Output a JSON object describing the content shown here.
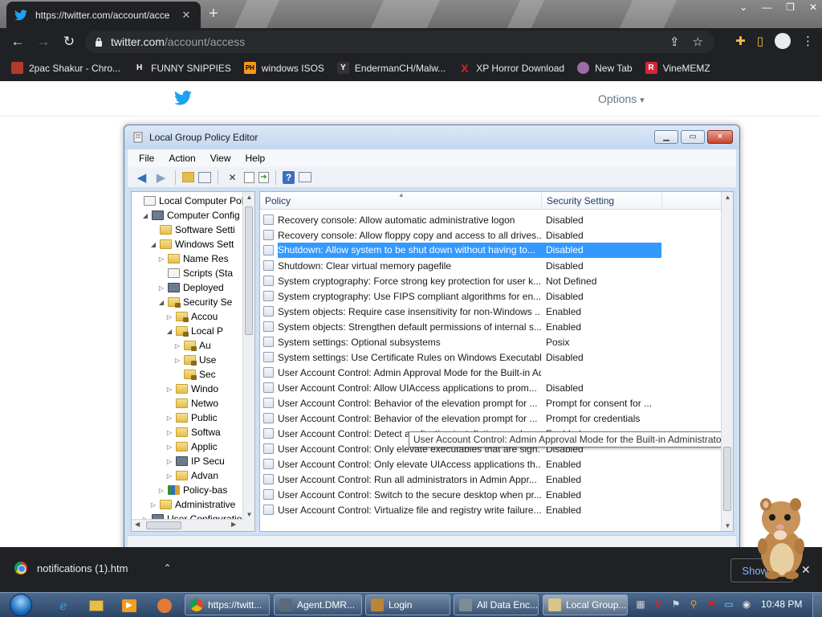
{
  "browser": {
    "tab_title": "https://twitter.com/account/acce",
    "tab_close": "✕",
    "new_tab": "+",
    "window_controls": [
      "⌄",
      "—",
      "❐",
      "✕"
    ],
    "omnibox_domain": "twitter.com",
    "omnibox_path": "/account/access",
    "bookmarks": [
      {
        "label": "2pac Shakur - Chro...",
        "icon": "pac-icon",
        "icon_text": "",
        "color": "#b23a2a"
      },
      {
        "label": "FUNNY SNIPPIES",
        "icon": "h-icon",
        "icon_text": "H",
        "color": "#222222"
      },
      {
        "label": "windows ISOS",
        "icon": "ph-icon",
        "icon_text": "PH",
        "color": "#f7971c"
      },
      {
        "label": "EndermanCH/Malw...",
        "icon": "yp-icon",
        "icon_text": "Y",
        "color": "#333333"
      },
      {
        "label": "XP Horror Download",
        "icon": "x-icon",
        "icon_text": "X",
        "color": "#e02020"
      },
      {
        "label": "New Tab",
        "icon": "globe-icon",
        "icon_text": "",
        "color": "#a06aa8"
      },
      {
        "label": "VineMEMZ",
        "icon": "r-icon",
        "icon_text": "R",
        "color": "#d4253a"
      }
    ]
  },
  "page": {
    "options_label": "Options",
    "options_caret": "▾"
  },
  "gpedit": {
    "title": "Local Group Policy Editor",
    "menu": [
      "File",
      "Action",
      "View",
      "Help"
    ],
    "tree": [
      {
        "label": "Local Computer Polic",
        "indent": 0,
        "arrow": "",
        "icon": "paper"
      },
      {
        "label": "Computer Config",
        "indent": 1,
        "arrow": "◢",
        "icon": "comp"
      },
      {
        "label": "Software Setti",
        "indent": 2,
        "arrow": "",
        "icon": "folder"
      },
      {
        "label": "Windows Sett",
        "indent": 2,
        "arrow": "◢",
        "icon": "folder"
      },
      {
        "label": "Name Res",
        "indent": 3,
        "arrow": "▷",
        "icon": "folder"
      },
      {
        "label": "Scripts (Sta",
        "indent": 3,
        "arrow": "",
        "icon": "paper"
      },
      {
        "label": "Deployed",
        "indent": 3,
        "arrow": "▷",
        "icon": "comp"
      },
      {
        "label": "Security Se",
        "indent": 3,
        "arrow": "◢",
        "icon": "lockf"
      },
      {
        "label": "Accou",
        "indent": 4,
        "arrow": "▷",
        "icon": "lockf"
      },
      {
        "label": "Local P",
        "indent": 4,
        "arrow": "◢",
        "icon": "lockf"
      },
      {
        "label": "Au",
        "indent": 5,
        "arrow": "▷",
        "icon": "lockf"
      },
      {
        "label": "Use",
        "indent": 5,
        "arrow": "▷",
        "icon": "lockf"
      },
      {
        "label": "Sec",
        "indent": 5,
        "arrow": "",
        "icon": "lockf"
      },
      {
        "label": "Windo",
        "indent": 4,
        "arrow": "▷",
        "icon": "folder"
      },
      {
        "label": "Netwo",
        "indent": 4,
        "arrow": "",
        "icon": "folder"
      },
      {
        "label": "Public",
        "indent": 4,
        "arrow": "▷",
        "icon": "folder"
      },
      {
        "label": "Softwa",
        "indent": 4,
        "arrow": "▷",
        "icon": "folder"
      },
      {
        "label": "Applic",
        "indent": 4,
        "arrow": "▷",
        "icon": "folder"
      },
      {
        "label": "IP Secu",
        "indent": 4,
        "arrow": "▷",
        "icon": "comp"
      },
      {
        "label": "Advan",
        "indent": 4,
        "arrow": "▷",
        "icon": "folder"
      },
      {
        "label": "Policy-bas",
        "indent": 3,
        "arrow": "▷",
        "icon": "chart"
      },
      {
        "label": "Administrative",
        "indent": 2,
        "arrow": "▷",
        "icon": "folder"
      },
      {
        "label": "User Configuratio",
        "indent": 1,
        "arrow": "▷",
        "icon": "comp"
      }
    ],
    "columns": {
      "policy": "Policy",
      "setting": "Security Setting"
    },
    "rows": [
      {
        "policy": "Recovery console: Allow automatic administrative logon",
        "setting": "Disabled"
      },
      {
        "policy": "Recovery console: Allow floppy copy and access to all drives...",
        "setting": "Disabled"
      },
      {
        "policy": "Shutdown: Allow system to be shut down without having to...",
        "setting": "Disabled"
      },
      {
        "policy": "Shutdown: Clear virtual memory pagefile",
        "setting": "Disabled"
      },
      {
        "policy": "System cryptography: Force strong key protection for user k...",
        "setting": "Not Defined"
      },
      {
        "policy": "System cryptography: Use FIPS compliant algorithms for en...",
        "setting": "Disabled"
      },
      {
        "policy": "System objects: Require case insensitivity for non-Windows ...",
        "setting": "Enabled"
      },
      {
        "policy": "System objects: Strengthen default permissions of internal s...",
        "setting": "Enabled"
      },
      {
        "policy": "System settings: Optional subsystems",
        "setting": "Posix"
      },
      {
        "policy": "System settings: Use Certificate Rules on Windows Executabl...",
        "setting": "Disabled"
      },
      {
        "policy": "User Account Control: Admin Approval Mode for the Built-in Administrator account",
        "setting": ""
      },
      {
        "policy": "User Account Control: Allow UIAccess applications to prom...",
        "setting": "Disabled"
      },
      {
        "policy": "User Account Control: Behavior of the elevation prompt for ...",
        "setting": "Prompt for consent for ..."
      },
      {
        "policy": "User Account Control: Behavior of the elevation prompt for ...",
        "setting": "Prompt for credentials"
      },
      {
        "policy": "User Account Control: Detect application installations and p...",
        "setting": "Enabled"
      },
      {
        "policy": "User Account Control: Only elevate executables that are sign...",
        "setting": "Disabled"
      },
      {
        "policy": "User Account Control: Only elevate UIAccess applications th...",
        "setting": "Enabled"
      },
      {
        "policy": "User Account Control: Run all administrators in Admin Appr...",
        "setting": "Enabled"
      },
      {
        "policy": "User Account Control: Switch to the secure desktop when pr...",
        "setting": "Enabled"
      },
      {
        "policy": "User Account Control: Virtualize file and registry write failure...",
        "setting": "Enabled"
      }
    ],
    "selected_row": 2,
    "tooltip": "User Account Control: Admin Approval Mode for the Built-in Administrator account"
  },
  "downloads": {
    "file": "notifications (1).htm",
    "show_all": "Show all",
    "close": "✕"
  },
  "taskbar": {
    "tasks": [
      {
        "label": "https://twitt...",
        "color": "#e8b23a",
        "active": false
      },
      {
        "label": "Agent.DMR...",
        "color": "#5a6a7a",
        "active": false
      },
      {
        "label": "Login",
        "color": "#b8863a",
        "active": false
      },
      {
        "label": "All Data Enc...",
        "color": "#7d8a98",
        "active": false
      },
      {
        "label": "Local Group...",
        "color": "#d7c58a",
        "active": true
      }
    ],
    "clock": "10:48 PM"
  }
}
